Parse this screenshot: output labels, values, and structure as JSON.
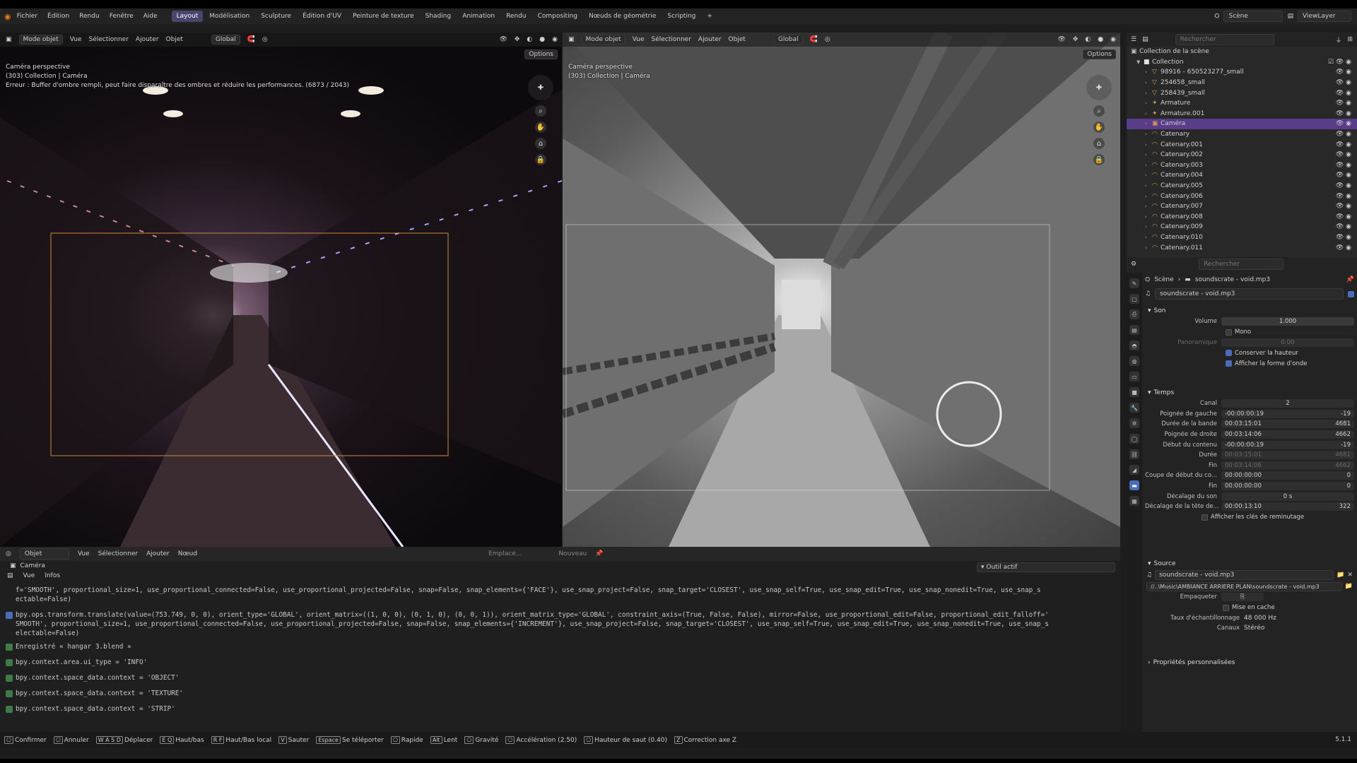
{
  "menu": [
    "Fichier",
    "Édition",
    "Rendu",
    "Fenêtre",
    "Aide"
  ],
  "workspaces": [
    "Layout",
    "Modélisation",
    "Sculpture",
    "Édition d'UV",
    "Peinture de texture",
    "Shading",
    "Animation",
    "Rendu",
    "Compositing",
    "Nœuds de géométrie",
    "Scripting"
  ],
  "workspace_add": "+",
  "topbar_right": {
    "scene": "Scène",
    "viewlayer": "ViewLayer"
  },
  "left_viewport": {
    "mode": "Mode objet",
    "menu": [
      "Vue",
      "Sélectionner",
      "Ajouter",
      "Objet"
    ],
    "orientation": "Global",
    "options": "Options",
    "overlay_line1": "Caméra perspective",
    "overlay_line2": "(303) Collection | Caméra",
    "overlay_line3": "Erreur : Buffer d'ombre rempli, peut faire disparaître des ombres et réduire les performances. (6873 / 2043)"
  },
  "right_viewport": {
    "mode": "Mode objet",
    "menu": [
      "Vue",
      "Sélectionner",
      "Ajouter",
      "Objet"
    ],
    "orientation": "Global",
    "options": "Options",
    "overlay_line1": "Caméra perspective",
    "overlay_line2": "(303) Collection | Caméra"
  },
  "outliner": {
    "search_placeholder": "Rechercher",
    "root": "Collection de la scène",
    "collection": "Collection",
    "items": [
      "98916 - 650523277_small",
      "254658_small",
      "258439_small",
      "Armature",
      "Armature.001",
      "Caméra",
      "Catenary",
      "Catenary.001",
      "Catenary.002",
      "Catenary.003",
      "Catenary.004",
      "Catenary.005",
      "Catenary.006",
      "Catenary.007",
      "Catenary.008",
      "Catenary.009",
      "Catenary.010",
      "Catenary.011"
    ],
    "selected": "Caméra"
  },
  "properties": {
    "search_placeholder": "Rechercher",
    "breadcrumb": [
      "Scène",
      "soundscrate - void.mp3"
    ],
    "strip_name": "soundscrate - void.mp3",
    "sections": {
      "son": "Son",
      "temps": "Temps",
      "source": "Source",
      "custom": "Propriétés personnalisées"
    },
    "son": {
      "volume_label": "Volume",
      "volume": "1.000",
      "mono": "Mono",
      "pan_label": "Panoramique",
      "pan": "0.00",
      "keep_pitch": "Conserver la hauteur",
      "show_wave": "Afficher la forme d'onde"
    },
    "temps": [
      {
        "label": "Canal",
        "value": "2",
        "right": ""
      },
      {
        "label": "Poignée de gauche",
        "value": "-00:00:00:19",
        "right": "-19"
      },
      {
        "label": "Durée de la bande",
        "value": "00:03:15:01",
        "right": "4681"
      },
      {
        "label": "Poignée de droite",
        "value": "00:03:14:06",
        "right": "4662"
      },
      {
        "label": "Début du contenu",
        "value": "-00:00:00:19",
        "right": "-19"
      },
      {
        "label": "Durée",
        "value": "00:03:15:01",
        "right": "4681"
      },
      {
        "label": "Fin",
        "value": "00:03:14:06",
        "right": "4662"
      },
      {
        "label": "Coupe de début du co...",
        "value": "00:00:00:00",
        "right": "0"
      },
      {
        "label": "Fin",
        "value": "00:00:00:00",
        "right": "0"
      },
      {
        "label": "Décalage du son",
        "value": "0 s",
        "right": ""
      },
      {
        "label": "Décalage de la tête de...",
        "value": "00:00:13:10",
        "right": "322"
      }
    ],
    "show_retiming": "Afficher les clés de reminutage",
    "source": {
      "file": "soundscrate - void.mp3",
      "path": "//..\\Music\\AMBIANCE ARRIERE PLAN\\soundscrate - void.mp3",
      "pack_label": "Empaqueter",
      "cache": "Mise en cache",
      "rate_label": "Taux d'échantillonnage",
      "rate": "48 000 Hz",
      "channels_label": "Canaux",
      "channels": "Stéréo"
    }
  },
  "console": {
    "header": {
      "editor": "Objet",
      "menu": [
        "Vue",
        "Sélectionner",
        "Ajouter",
        "Nœud"
      ],
      "slot": "Emplace...",
      "new": "Nouveau"
    },
    "camera_label": "Caméra",
    "info_menu": [
      "Vue",
      "Infos"
    ],
    "active_tool": "Outil actif",
    "lines": [
      "f='SMOOTH', proportional_size=1, use_proportional_connected=False, use_proportional_projected=False, snap=False, snap_elements={'FACE'}, use_snap_project=False, snap_target='CLOSEST', use_snap_self=True, use_snap_edit=True, use_snap_nonedit=True, use_snap_s",
      "ectable=False)",
      "bpy.ops.transform.translate(value=(753.749, 0, 0), orient_type='GLOBAL', orient_matrix=((1, 0, 0), (0, 1, 0), (0, 0, 1)), orient_matrix_type='GLOBAL', constraint_axis=(True, False, False), mirror=False, use_proportional_edit=False, proportional_edit_falloff='",
      "SMOOTH', proportional_size=1, use_proportional_connected=False, use_proportional_projected=False, snap=False, snap_elements={'INCREMENT'}, use_snap_project=False, snap_target='CLOSEST', use_snap_self=True, use_snap_edit=True, use_snap_nonedit=True, use_snap_s",
      "electable=False)",
      "Enregistré « hangar 3.blend »",
      "bpy.context.area.ui_type = 'INFO'",
      "bpy.context.space_data.context = 'OBJECT'",
      "bpy.context.space_data.context = 'TEXTURE'",
      "bpy.context.space_data.context = 'STRIP'"
    ]
  },
  "statusbar": [
    {
      "key": "",
      "label": "Confirmer"
    },
    {
      "key": "",
      "label": "Annuler"
    },
    {
      "key": "W A S D",
      "label": "Déplacer"
    },
    {
      "key": "E Q",
      "label": "Haut/bas"
    },
    {
      "key": "R F",
      "label": "Haut/Bas local"
    },
    {
      "key": "V",
      "label": "Sauter"
    },
    {
      "key": "Espace",
      "label": "Se téléporter"
    },
    {
      "key": "",
      "label": "Rapide"
    },
    {
      "key": "Alt",
      "label": "Lent"
    },
    {
      "key": "",
      "label": "Gravité"
    },
    {
      "key": "",
      "label": "Accélération (2.50)"
    },
    {
      "key": "",
      "label": "Hauteur de saut (0.40)"
    },
    {
      "key": "Z",
      "label": "Correction axe Z"
    }
  ],
  "version": "5.1.1"
}
